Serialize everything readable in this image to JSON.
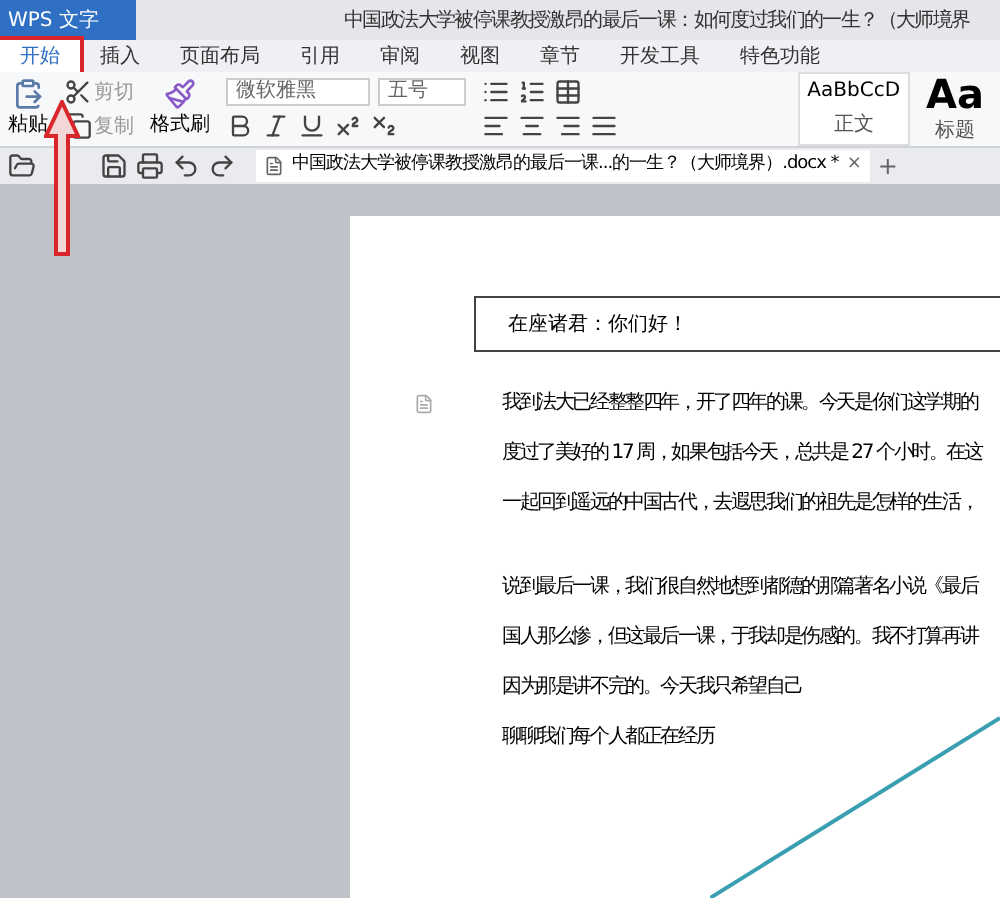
{
  "app_button": "WPS 文字",
  "window": {
    "title": "中国政法大学被停课教授激昂的最后一课：如何度过我们的一生？（大师境界"
  },
  "tabs": [
    {
      "label": "开始",
      "selected": true,
      "highlighted": true
    },
    {
      "label": "插入",
      "selected": false,
      "highlighted": false
    },
    {
      "label": "页面布局",
      "selected": false,
      "highlighted": false
    },
    {
      "label": "引用",
      "selected": false,
      "highlighted": false
    },
    {
      "label": "审阅",
      "selected": false,
      "highlighted": false
    },
    {
      "label": "视图",
      "selected": false,
      "highlighted": false
    },
    {
      "label": "章节",
      "selected": false,
      "highlighted": false
    },
    {
      "label": "开发工具",
      "selected": false,
      "highlighted": false
    },
    {
      "label": "特色功能",
      "selected": false,
      "highlighted": false
    }
  ],
  "clipboard": {
    "paste": "粘贴",
    "cut": "剪切",
    "copy": "复制",
    "format_painter": "格式刷"
  },
  "font": {
    "family": "微软雅黑",
    "size": "五号"
  },
  "styles": [
    {
      "sample": "AaBbCcD",
      "name": "正文",
      "kind": "small"
    },
    {
      "sample": "Aa",
      "name": "标题",
      "kind": "large"
    }
  ],
  "doc_tab": {
    "title": "中国政法大学被停课教授激昂的最后一课...的一生？（大师境界）.docx *",
    "close": "×",
    "new": "+"
  },
  "document": {
    "greeting": "在座诸君：你们好！",
    "paragraphs": [
      [
        "我到法大已经整整四年，开了四年的课。今天是你们这学期的",
        "度过了美好的 17 周，如果包括今天，总共是 27 个小时。在这",
        "一起回到遥远的中国古代，去遐思我们的祖先是怎样的生活，"
      ],
      [
        "说到最后一课，我们很自然地想到都德的那篇著名小说《最后",
        "国人那么惨，但这最后一课，于我却是伤感的。我不打算再讲",
        "因为那是讲不完的。今天我只希望自己",
        "聊聊我们每个人都正在经历"
      ]
    ]
  }
}
